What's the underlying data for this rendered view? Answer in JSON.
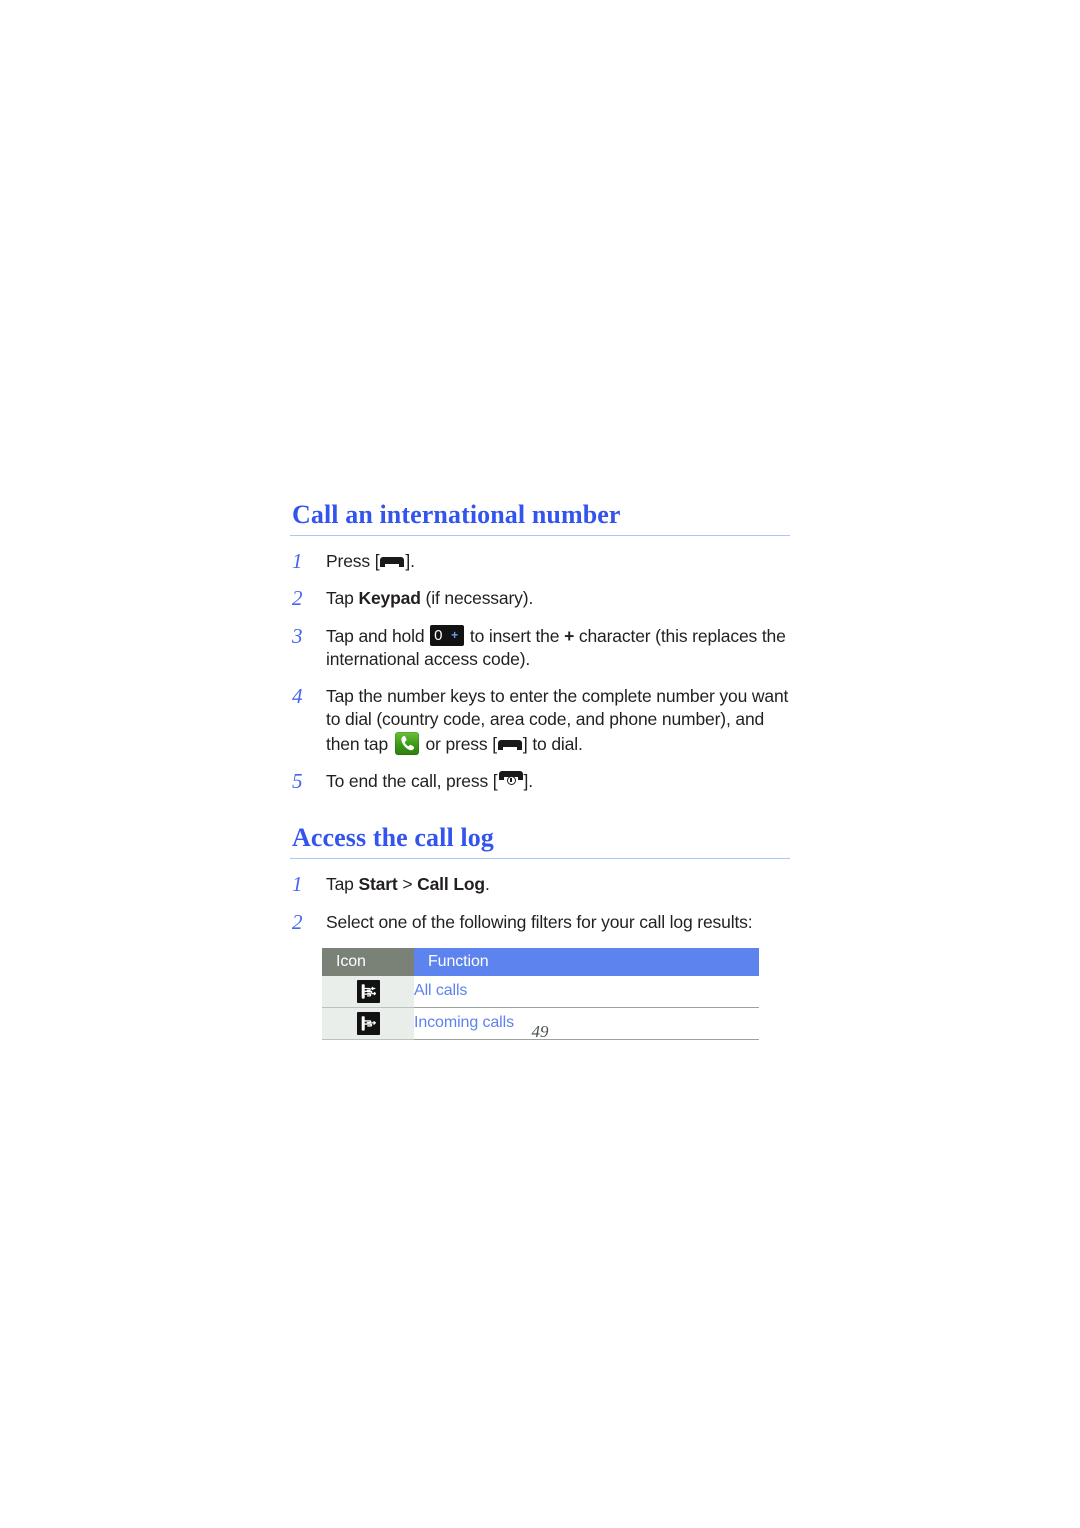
{
  "document": {
    "page_number": "49"
  },
  "colors": {
    "heading_blue": "#3355ee",
    "step_number_blue": "#4466ee",
    "rule_blue": "#a8c8f5",
    "table_header_icon_gray": "#7a8278",
    "table_header_function_blue": "#5d83ee",
    "table_function_text_blue": "#5d83ee",
    "icon_cell_background": "#e9eeea",
    "body_text": "#231f20",
    "call_key_green": "#3c9a16"
  },
  "sections": [
    {
      "heading": "Call an international number",
      "steps": [
        {
          "number": "1",
          "parts": [
            {
              "type": "text",
              "value": "Press ["
            },
            {
              "type": "icon",
              "icon": "send-key-icon"
            },
            {
              "type": "text",
              "value": "]."
            }
          ]
        },
        {
          "number": "2",
          "parts": [
            {
              "type": "text",
              "value": "Tap "
            },
            {
              "type": "bold",
              "value": "Keypad"
            },
            {
              "type": "text",
              "value": " (if necessary)."
            }
          ]
        },
        {
          "number": "3",
          "parts": [
            {
              "type": "text",
              "value": "Tap and hold "
            },
            {
              "type": "icon",
              "icon": "zero-plus-key-icon",
              "label": "0",
              "secondary_label": "+"
            },
            {
              "type": "text",
              "value": " to insert the "
            },
            {
              "type": "bold",
              "value": "+"
            },
            {
              "type": "text",
              "value": " character (this replaces the international access code)."
            }
          ]
        },
        {
          "number": "4",
          "parts": [
            {
              "type": "text",
              "value": "Tap the number keys to enter the complete number you want to dial (country code, area code, and phone number), and then tap "
            },
            {
              "type": "icon",
              "icon": "green-call-key-icon"
            },
            {
              "type": "text",
              "value": " or press ["
            },
            {
              "type": "icon",
              "icon": "send-key-icon"
            },
            {
              "type": "text",
              "value": "] to dial."
            }
          ]
        },
        {
          "number": "5",
          "parts": [
            {
              "type": "text",
              "value": "To end the call, press ["
            },
            {
              "type": "icon",
              "icon": "end-key-icon"
            },
            {
              "type": "text",
              "value": "]."
            }
          ]
        }
      ]
    },
    {
      "heading": "Access the call log",
      "steps": [
        {
          "number": "1",
          "parts": [
            {
              "type": "text",
              "value": "Tap "
            },
            {
              "type": "bold",
              "value": "Start"
            },
            {
              "type": "text",
              "value": " > "
            },
            {
              "type": "bold",
              "value": "Call Log"
            },
            {
              "type": "text",
              "value": "."
            }
          ]
        },
        {
          "number": "2",
          "parts": [
            {
              "type": "text",
              "value": "Select one of the following filters for your call log results:"
            }
          ]
        }
      ]
    }
  ],
  "filter_table": {
    "headers": {
      "icon": "Icon",
      "function": "Function"
    },
    "rows": [
      {
        "icon": "all-calls-icon",
        "function": "All calls"
      },
      {
        "icon": "incoming-calls-icon",
        "function": "Incoming calls"
      }
    ]
  },
  "step_text": {
    "s1_a": "Press [",
    "s1_b": "].",
    "s2_a": "Tap ",
    "s2_bold": "Keypad",
    "s2_b": " (if necessary).",
    "s3_a": "Tap and hold ",
    "s3_b": " to insert the ",
    "s3_plus": "+",
    "s3_c": " character (this replaces the international access code).",
    "s4_a": "Tap the number keys to enter the complete number you want to dial (country code, area code, and phone number), and then tap ",
    "s4_b": " or press [",
    "s4_c": "] to dial.",
    "s5_a": "To end the call, press [",
    "s5_b": ".",
    "s5_close": "]",
    "l1_a": "Tap ",
    "l1_bold1": "Start",
    "l1_mid": " > ",
    "l1_bold2": "Call Log",
    "l1_b": ".",
    "l2_a": "Select one of the following filters for your call log results:"
  },
  "key_labels": {
    "zero": "0",
    "plus": "+"
  },
  "step_numbers": {
    "n1": "1",
    "n2": "2",
    "n3": "3",
    "n4": "4",
    "n5": "5"
  }
}
